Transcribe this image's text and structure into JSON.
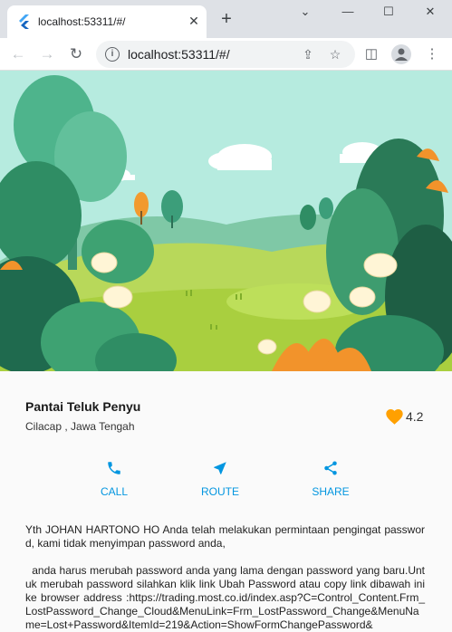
{
  "browser": {
    "tab_title": "localhost:53311/#/",
    "url": "localhost:53311/#/",
    "new_tab_glyph": "+",
    "icons": [
      "flutter-favicon",
      "close-icon",
      "plus-icon",
      "minimize-icon",
      "maximize-icon",
      "close-window-icon",
      "back-arrow-icon",
      "forward-arrow-icon",
      "reload-icon",
      "info-icon",
      "share-icon",
      "star-icon",
      "sidebar-icon",
      "profile-icon",
      "more-vertical-icon"
    ]
  },
  "place": {
    "title": "Pantai Teluk Penyu",
    "location": "Cilacap , Jawa Tengah",
    "rating": "4.2",
    "heart_color": "#ffa000"
  },
  "actions": [
    {
      "label": "CALL",
      "icon": "phone-icon"
    },
    {
      "label": "ROUTE",
      "icon": "navigation-icon"
    },
    {
      "label": "SHARE",
      "icon": "share-icon"
    }
  ],
  "accent_color": "#0396e0",
  "description": {
    "para1": "Yth JOHAN HARTONO HO Anda telah melakukan permintaan pengingat password, kami tidak menyimpan password anda,",
    "para2": "  anda harus merubah password anda yang lama dengan password yang baru.Untuk merubah password silahkan klik link Ubah Password atau copy link dibawah ini ke browser address :https://trading.most.co.id/index.asp?C=Control_Content.Frm_LostPassword_Change_Cloud&MenuLink=Frm_LostPassword_Change&MenuName=Lost+Password&ItemId=219&Action=ShowFormChangePassword&"
  }
}
